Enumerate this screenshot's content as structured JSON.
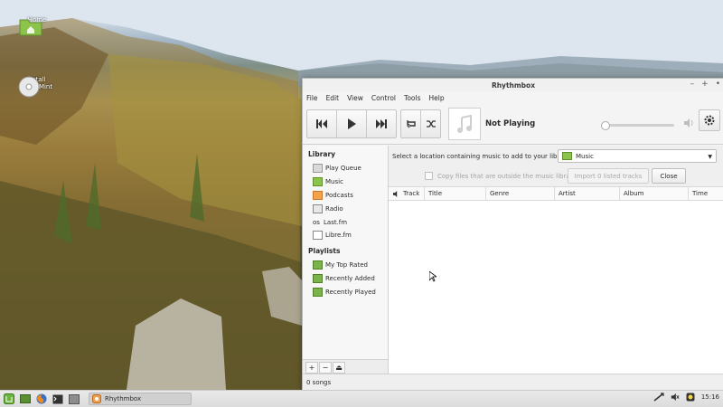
{
  "desktop": {
    "icons": [
      {
        "label": "Home"
      },
      {
        "label": "Install Linux Mint"
      }
    ]
  },
  "window": {
    "title": "Rhythmbox",
    "controls": {
      "minimize": "–",
      "maximize": "+",
      "close": "•"
    },
    "menu": [
      "File",
      "Edit",
      "View",
      "Control",
      "Tools",
      "Help"
    ],
    "now_playing": "Not Playing",
    "sidebar": {
      "library_header": "Library",
      "library_items": [
        "Play Queue",
        "Music",
        "Podcasts",
        "Radio",
        "Last.fm",
        "Libre.fm"
      ],
      "playlists_header": "Playlists",
      "playlist_items": [
        "My Top Rated",
        "Recently Added",
        "Recently Played"
      ],
      "tools": [
        "+",
        "−",
        "⏏"
      ]
    },
    "import": {
      "prompt": "Select a location containing music to add to your library:",
      "location": "Music",
      "copy_label": "Copy files that are outside the music library",
      "import_button": "Import 0 listed tracks",
      "close_button": "Close"
    },
    "columns": [
      "Track",
      "Title",
      "Genre",
      "Artist",
      "Album",
      "Time"
    ],
    "status": "0 songs"
  },
  "taskbar": {
    "task_label": "Rhythmbox",
    "clock": "15:16"
  },
  "colors": {
    "accent_green": "#6cb33f",
    "folder_green": "#8cc34b"
  }
}
